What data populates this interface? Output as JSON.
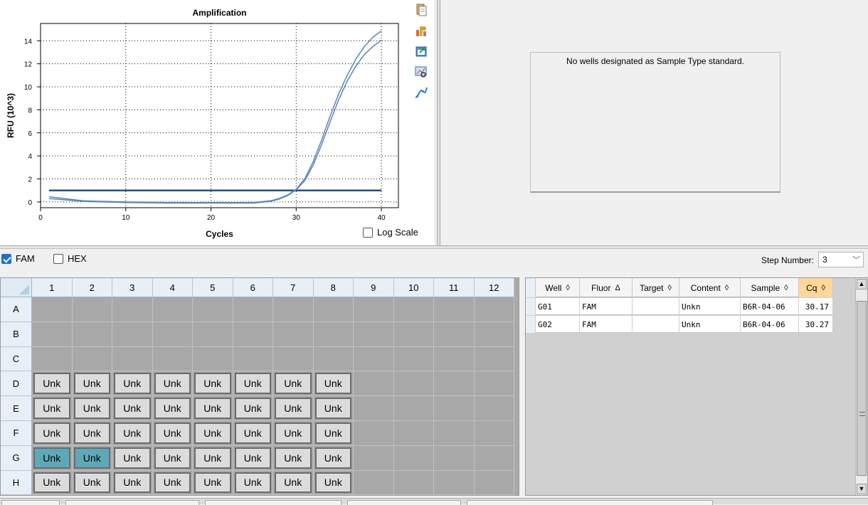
{
  "amplification_chart": {
    "toolbar_icons": [
      "copy-icon",
      "chart-settings-icon",
      "export-icon",
      "zoom-icon",
      "curve-fit-icon"
    ],
    "log_scale": {
      "label": "Log Scale",
      "checked": false
    }
  },
  "chart_data": {
    "type": "line",
    "title": "Amplification",
    "xlabel": "Cycles",
    "ylabel": "RFU (10^3)",
    "xlim": [
      0,
      42
    ],
    "ylim": [
      -0.5,
      15.5
    ],
    "x_ticks": [
      0,
      10,
      20,
      30,
      40
    ],
    "y_ticks": [
      0,
      2,
      4,
      6,
      8,
      10,
      12,
      14
    ],
    "grid": true,
    "series": [
      {
        "color": "#5b86b5",
        "x": [
          1,
          5,
          10,
          15,
          20,
          25,
          27,
          28,
          29,
          30,
          31,
          32,
          33,
          34,
          35,
          36,
          37,
          38,
          39,
          40
        ],
        "y": [
          0.45,
          0.1,
          0.0,
          -0.05,
          -0.05,
          -0.05,
          0.1,
          0.3,
          0.6,
          1.1,
          2.0,
          3.5,
          5.4,
          7.5,
          9.4,
          11.0,
          12.4,
          13.5,
          14.3,
          14.85
        ]
      },
      {
        "color": "#5b86b5",
        "x": [
          1,
          5,
          10,
          15,
          20,
          25,
          27,
          28,
          29,
          30,
          31,
          32,
          33,
          34,
          35,
          36,
          37,
          38,
          39,
          40
        ],
        "y": [
          0.3,
          0.05,
          -0.05,
          -0.1,
          -0.1,
          -0.1,
          0.05,
          0.25,
          0.55,
          1.05,
          1.85,
          3.2,
          5.0,
          7.0,
          8.9,
          10.5,
          11.8,
          12.8,
          13.5,
          14.05
        ]
      }
    ],
    "threshold": {
      "y": 1.0,
      "color": "#1f4f8c"
    }
  },
  "std_curve": {
    "message": "No wells designated as Sample Type standard."
  },
  "fluors": [
    {
      "label": "FAM",
      "checked": true
    },
    {
      "label": "HEX",
      "checked": false
    }
  ],
  "step": {
    "label": "Step Number:",
    "value": "3"
  },
  "plate": {
    "columns": [
      "1",
      "2",
      "3",
      "4",
      "5",
      "6",
      "7",
      "8",
      "9",
      "10",
      "11",
      "12"
    ],
    "rows": [
      {
        "label": "A",
        "wells": [
          "",
          "",
          "",
          "",
          "",
          "",
          "",
          "",
          "",
          "",
          "",
          ""
        ]
      },
      {
        "label": "B",
        "wells": [
          "",
          "",
          "",
          "",
          "",
          "",
          "",
          "",
          "",
          "",
          "",
          ""
        ]
      },
      {
        "label": "C",
        "wells": [
          "",
          "",
          "",
          "",
          "",
          "",
          "",
          "",
          "",
          "",
          "",
          ""
        ]
      },
      {
        "label": "D",
        "wells": [
          "Unk",
          "Unk",
          "Unk",
          "Unk",
          "Unk",
          "Unk",
          "Unk",
          "Unk",
          "",
          "",
          "",
          ""
        ]
      },
      {
        "label": "E",
        "wells": [
          "Unk",
          "Unk",
          "Unk",
          "Unk",
          "Unk",
          "Unk",
          "Unk",
          "Unk",
          "",
          "",
          "",
          ""
        ]
      },
      {
        "label": "F",
        "wells": [
          "Unk",
          "Unk",
          "Unk",
          "Unk",
          "Unk",
          "Unk",
          "Unk",
          "Unk",
          "",
          "",
          "",
          ""
        ]
      },
      {
        "label": "G",
        "wells": [
          "Unk",
          "Unk",
          "Unk",
          "Unk",
          "Unk",
          "Unk",
          "Unk",
          "Unk",
          "",
          "",
          "",
          ""
        ]
      },
      {
        "label": "H",
        "wells": [
          "Unk",
          "Unk",
          "Unk",
          "Unk",
          "Unk",
          "Unk",
          "Unk",
          "Unk",
          "",
          "",
          "",
          ""
        ]
      }
    ],
    "selected_wells": [
      "G1",
      "G2"
    ]
  },
  "results_table": {
    "headers": [
      {
        "label": "Well",
        "sort": "◊"
      },
      {
        "label": "Fluor",
        "sort": "Δ"
      },
      {
        "label": "Target",
        "sort": "◊"
      },
      {
        "label": "Content",
        "sort": "◊"
      },
      {
        "label": "Sample",
        "sort": "◊"
      },
      {
        "label": "Cq",
        "sort": "◊"
      }
    ],
    "rows": [
      [
        "G01",
        "FAM",
        "",
        "Unkn",
        "B6R-04-06",
        "30.17"
      ],
      [
        "G02",
        "FAM",
        "",
        "Unkn",
        "B6R-04-06",
        "30.27"
      ]
    ]
  }
}
